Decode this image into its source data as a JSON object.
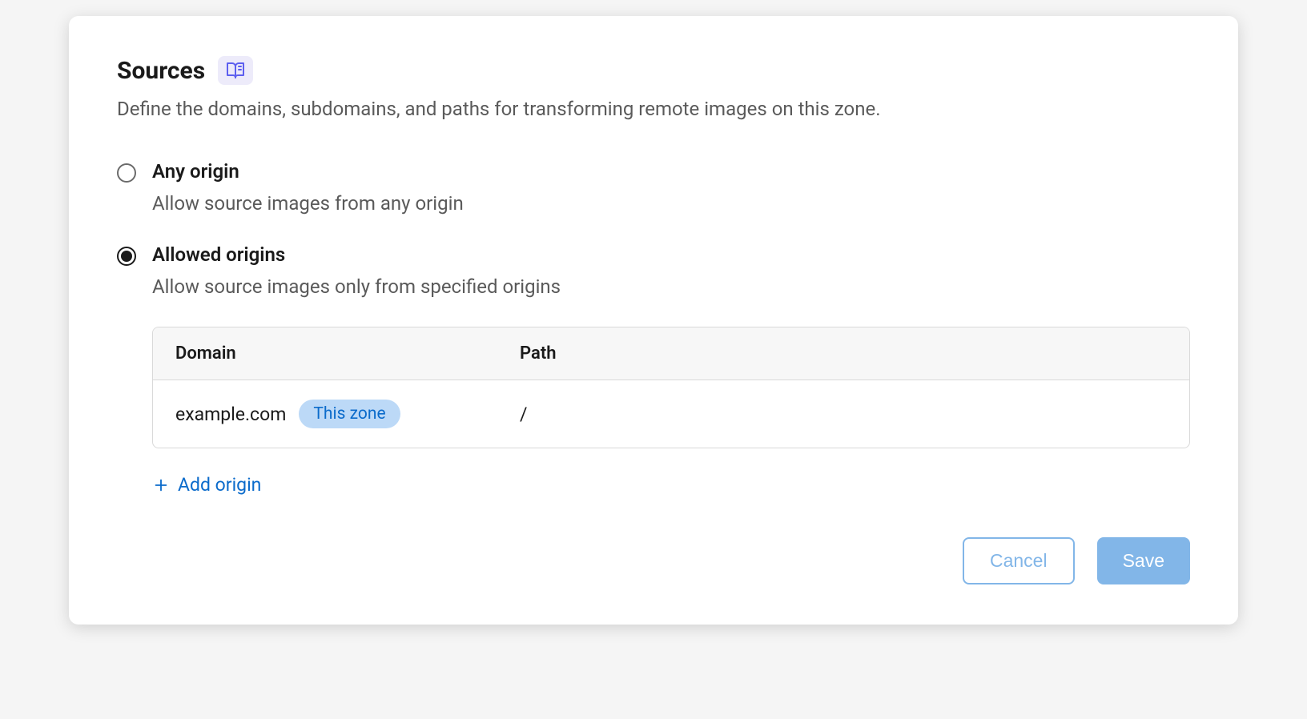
{
  "header": {
    "title": "Sources"
  },
  "description": "Define the domains, subdomains, and paths for transforming remote images on this zone.",
  "options": {
    "any_origin": {
      "title": "Any origin",
      "subtitle": "Allow source images from any origin",
      "selected": false
    },
    "allowed_origins": {
      "title": "Allowed origins",
      "subtitle": "Allow source images only from specified origins",
      "selected": true
    }
  },
  "table": {
    "headers": {
      "domain": "Domain",
      "path": "Path"
    },
    "rows": [
      {
        "domain": "example.com",
        "badge": "This zone",
        "path": "/"
      }
    ]
  },
  "actions": {
    "add_origin": "Add origin",
    "cancel": "Cancel",
    "save": "Save"
  }
}
